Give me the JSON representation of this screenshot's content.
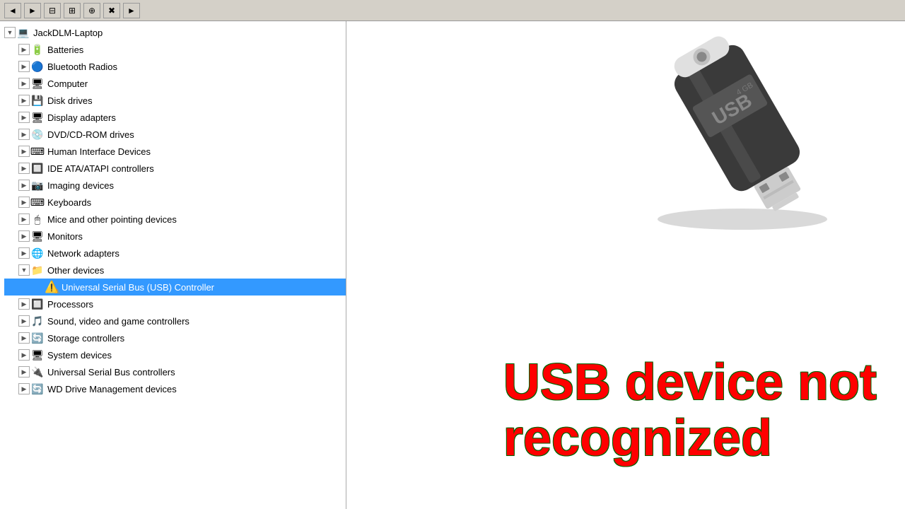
{
  "toolbar": {
    "buttons": [
      "◄",
      "►",
      "⊟",
      "⊞",
      "⊕",
      "✖",
      "►"
    ]
  },
  "tree": {
    "root": {
      "label": "JackDLM-Laptop",
      "icon": "💻",
      "items": [
        {
          "label": "Batteries",
          "icon": "🔋",
          "expanded": false
        },
        {
          "label": "Bluetooth Radios",
          "icon": "🔵",
          "expanded": false
        },
        {
          "label": "Computer",
          "icon": "🖥",
          "expanded": false
        },
        {
          "label": "Disk drives",
          "icon": "💾",
          "expanded": false
        },
        {
          "label": "Display adapters",
          "icon": "🖥",
          "expanded": false
        },
        {
          "label": "DVD/CD-ROM drives",
          "icon": "💿",
          "expanded": false
        },
        {
          "label": "Human Interface Devices",
          "icon": "⌨",
          "expanded": false
        },
        {
          "label": "IDE ATA/ATAPI controllers",
          "icon": "🔲",
          "expanded": false
        },
        {
          "label": "Imaging devices",
          "icon": "📷",
          "expanded": false
        },
        {
          "label": "Keyboards",
          "icon": "⌨",
          "expanded": false
        },
        {
          "label": "Mice and other pointing devices",
          "icon": "🖱",
          "expanded": false
        },
        {
          "label": "Monitors",
          "icon": "🖥",
          "expanded": false
        },
        {
          "label": "Network adapters",
          "icon": "🌐",
          "expanded": false
        },
        {
          "label": "Other devices",
          "icon": "❓",
          "expanded": true,
          "children": [
            {
              "label": "Universal Serial Bus (USB) Controller",
              "icon": "⚠",
              "selected": true
            }
          ]
        },
        {
          "label": "Processors",
          "icon": "🔲",
          "expanded": false
        },
        {
          "label": "Sound, video and game controllers",
          "icon": "🎵",
          "expanded": false
        },
        {
          "label": "Storage controllers",
          "icon": "🔄",
          "expanded": false
        },
        {
          "label": "System devices",
          "icon": "🖥",
          "expanded": false
        },
        {
          "label": "Universal Serial Bus controllers",
          "icon": "🔌",
          "expanded": false
        },
        {
          "label": "WD Drive Management devices",
          "icon": "🔄",
          "expanded": false
        }
      ]
    }
  },
  "message": {
    "line1": "USB device not",
    "line2": "recognized"
  }
}
